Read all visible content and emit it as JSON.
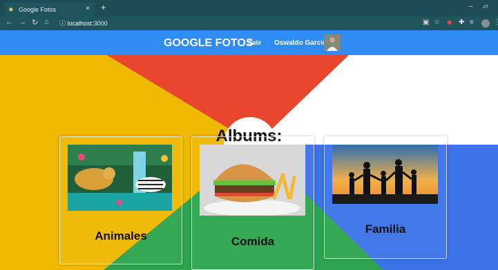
{
  "browser": {
    "tab_title": "Google Fotos",
    "tab_close": "×",
    "new_tab": "+",
    "window_controls": "– ▱",
    "address_info_icon": "info-icon",
    "address_host": "localhost",
    "address_port": ":3000"
  },
  "header": {
    "brand": "GOOGLE FOTOS",
    "logout": "Salir",
    "user_name": "Oswaldo Garcia"
  },
  "main": {
    "title": "Albums:",
    "albums": [
      {
        "label": "Animales"
      },
      {
        "label": "Comida"
      },
      {
        "label": "Familia"
      }
    ]
  },
  "colors": {
    "header": "#2f8cf3",
    "yellow": "#f0b800",
    "red": "#e8472d",
    "green": "#2ea44f",
    "blue": "#3b73e8"
  }
}
